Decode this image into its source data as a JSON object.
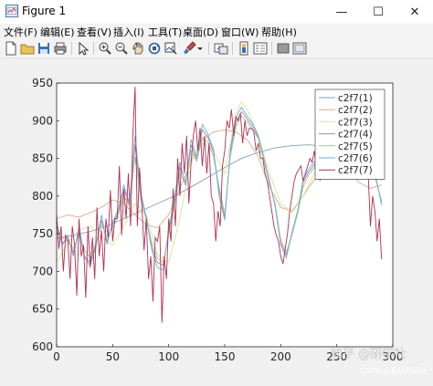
{
  "window": {
    "title": "Figure 1",
    "minimize_label": "—",
    "maximize_label": "☐",
    "close_label": "✕"
  },
  "menu": [
    "文件(F)",
    "编辑(E)",
    "查看(V)",
    "插入(I)",
    "工具(T)",
    "桌面(D)",
    "窗口(W)",
    "帮助(H)"
  ],
  "toolbar_icons": [
    "new-figure-icon",
    "open-file-icon",
    "save-icon",
    "print-icon",
    "edit-plot-icon",
    "zoom-in-icon",
    "zoom-out-icon",
    "pan-icon",
    "rotate-3d-icon",
    "data-cursor-icon",
    "brush-icon",
    "brush-dropdown-icon",
    "link-plot-icon",
    "insert-colorbar-icon",
    "insert-legend-icon",
    "hide-plot-tools-icon",
    "show-plot-tools-icon"
  ],
  "watermark": {
    "line1": "知乎 @研学社",
    "line2": "CSDN @荔枝科研社"
  },
  "chart_data": {
    "type": "line",
    "xlim": [
      0,
      300
    ],
    "ylim": [
      600,
      950
    ],
    "xticks": [
      "0",
      "50",
      "100",
      "150",
      "200",
      "250",
      "300"
    ],
    "yticks": [
      "600",
      "650",
      "700",
      "750",
      "800",
      "850",
      "900",
      "950"
    ],
    "xtick_values": [
      0,
      50,
      100,
      150,
      200,
      250,
      300
    ],
    "ytick_values": [
      600,
      650,
      700,
      750,
      800,
      850,
      900,
      950
    ],
    "legend_position": "top-right",
    "grid": false,
    "series": [
      {
        "name": "c2f7(1)",
        "color": "#7fa0c0",
        "x": [
          0,
          15,
          30,
          45,
          60,
          75,
          90,
          105,
          120,
          135,
          150,
          165,
          180,
          195,
          210,
          225,
          240,
          255,
          270,
          285,
          290
        ],
        "y": [
          744,
          748,
          753,
          760,
          770,
          780,
          790,
          800,
          812,
          825,
          838,
          850,
          858,
          864,
          867,
          868,
          866,
          862,
          855,
          847,
          845
        ]
      },
      {
        "name": "c2f7(2)",
        "color": "#d6ad8c",
        "x": [
          0,
          10,
          20,
          30,
          40,
          50,
          60,
          70,
          80,
          90,
          100,
          110,
          120,
          130,
          140,
          150,
          160,
          170,
          180,
          190,
          200,
          210,
          220,
          230,
          240,
          250,
          260,
          270,
          280,
          290
        ],
        "y": [
          770,
          775,
          772,
          778,
          785,
          795,
          790,
          775,
          762,
          758,
          775,
          810,
          845,
          875,
          885,
          888,
          885,
          875,
          852,
          812,
          785,
          780,
          800,
          822,
          838,
          843,
          835,
          818,
          810,
          815
        ]
      },
      {
        "name": "c2f7(3)",
        "color": "#e3df93",
        "x": [
          0,
          10,
          20,
          30,
          40,
          50,
          60,
          70,
          80,
          90,
          100,
          110,
          120,
          130,
          140,
          150,
          160,
          165,
          170,
          180,
          190,
          200,
          210,
          220,
          230,
          240,
          250,
          260,
          270,
          280,
          290
        ],
        "y": [
          712,
          738,
          755,
          760,
          745,
          735,
          760,
          790,
          775,
          722,
          712,
          770,
          850,
          870,
          860,
          830,
          910,
          925,
          915,
          880,
          830,
          790,
          778,
          800,
          830,
          850,
          848,
          835,
          828,
          840,
          820
        ]
      },
      {
        "name": "c2f7(4)",
        "color": "#9b8ab0",
        "x": [
          0,
          5,
          10,
          15,
          20,
          25,
          30,
          35,
          40,
          45,
          50,
          55,
          60,
          65,
          70,
          75,
          80,
          85,
          90,
          95,
          100,
          105,
          110,
          115,
          120,
          125,
          130,
          135,
          140,
          145,
          150,
          155,
          160,
          165,
          170,
          175,
          180,
          185,
          190,
          195,
          200,
          205,
          210,
          215,
          220,
          225,
          230,
          235,
          240,
          245,
          250,
          255,
          260,
          265,
          270,
          275,
          280,
          285,
          290
        ],
        "y": [
          760,
          738,
          742,
          725,
          752,
          720,
          712,
          735,
          768,
          740,
          762,
          778,
          808,
          792,
          868,
          802,
          772,
          732,
          712,
          708,
          752,
          792,
          838,
          818,
          868,
          848,
          888,
          878,
          858,
          808,
          772,
          858,
          898,
          912,
          902,
          892,
          878,
          848,
          818,
          788,
          738,
          722,
          748,
          778,
          818,
          832,
          842,
          822,
          832,
          852,
          848,
          838,
          852,
          862,
          858,
          838,
          848,
          822,
          792
        ]
      },
      {
        "name": "c2f7(5)",
        "color": "#a8c890",
        "x": [
          0,
          5,
          10,
          15,
          20,
          25,
          30,
          35,
          40,
          45,
          50,
          55,
          60,
          65,
          70,
          75,
          80,
          85,
          90,
          95,
          100,
          105,
          110,
          115,
          120,
          125,
          130,
          135,
          140,
          145,
          150,
          155,
          160,
          165,
          170,
          175,
          180,
          185,
          190,
          195,
          200,
          205,
          210,
          215,
          220,
          225,
          230,
          235,
          240,
          245,
          250,
          255,
          260,
          265,
          270,
          275,
          280,
          285,
          290
        ],
        "y": [
          752,
          745,
          740,
          730,
          748,
          728,
          718,
          738,
          762,
          746,
          758,
          774,
          800,
          788,
          852,
          796,
          768,
          738,
          718,
          712,
          748,
          786,
          830,
          816,
          860,
          846,
          878,
          872,
          852,
          812,
          776,
          852,
          892,
          906,
          898,
          888,
          876,
          846,
          816,
          790,
          742,
          726,
          748,
          776,
          812,
          828,
          838,
          820,
          830,
          848,
          844,
          836,
          848,
          858,
          854,
          836,
          844,
          820,
          794
        ]
      },
      {
        "name": "c2f7(6)",
        "color": "#6aaed8",
        "x": [
          0,
          5,
          10,
          15,
          20,
          25,
          30,
          35,
          40,
          45,
          50,
          55,
          60,
          65,
          70,
          75,
          80,
          85,
          90,
          95,
          100,
          105,
          110,
          115,
          120,
          125,
          130,
          135,
          140,
          145,
          150,
          155,
          160,
          165,
          170,
          175,
          180,
          185,
          190,
          195,
          200,
          205,
          210,
          215,
          220,
          225,
          230,
          235,
          240,
          245,
          250,
          255,
          260,
          265,
          270,
          275,
          280,
          285,
          290
        ],
        "y": [
          765,
          735,
          748,
          720,
          760,
          718,
          708,
          732,
          775,
          736,
          766,
          782,
          815,
          788,
          880,
          806,
          770,
          728,
          705,
          702,
          756,
          796,
          845,
          814,
          875,
          852,
          895,
          882,
          862,
          800,
          768,
          862,
          905,
          918,
          906,
          896,
          880,
          850,
          820,
          786,
          735,
          718,
          752,
          780,
          822,
          836,
          846,
          826,
          836,
          856,
          852,
          840,
          856,
          866,
          862,
          840,
          852,
          824,
          788
        ]
      },
      {
        "name": "c2f7(7)",
        "color": "#b03050",
        "x": [
          0,
          2,
          4,
          6,
          8,
          10,
          12,
          14,
          16,
          18,
          20,
          22,
          24,
          26,
          28,
          30,
          32,
          34,
          36,
          38,
          40,
          42,
          44,
          46,
          48,
          50,
          52,
          54,
          56,
          58,
          60,
          62,
          64,
          66,
          68,
          70,
          72,
          74,
          76,
          78,
          80,
          82,
          84,
          86,
          88,
          90,
          92,
          94,
          96,
          98,
          100,
          102,
          104,
          106,
          108,
          110,
          112,
          114,
          116,
          118,
          120,
          122,
          124,
          126,
          128,
          130,
          132,
          134,
          136,
          138,
          140,
          142,
          144,
          146,
          148,
          150,
          152,
          154,
          156,
          158,
          160,
          162,
          164,
          166,
          168,
          170,
          172,
          174,
          176,
          178,
          180,
          182,
          184,
          186,
          188,
          190,
          192,
          194,
          196,
          198,
          200,
          202,
          204,
          206,
          208,
          210,
          212,
          214,
          216,
          218,
          220,
          222,
          224,
          226,
          228,
          230,
          232,
          234,
          236,
          238,
          240,
          242,
          244,
          246,
          248,
          250,
          252,
          254,
          256,
          258,
          260,
          262,
          264,
          266,
          268,
          270,
          272,
          274,
          276,
          278,
          280,
          282,
          284,
          286,
          288,
          290
        ],
        "y": [
          775,
          730,
          760,
          700,
          748,
          742,
          690,
          760,
          735,
          668,
          770,
          720,
          735,
          665,
          760,
          705,
          745,
          690,
          785,
          720,
          755,
          700,
          770,
          745,
          808,
          740,
          770,
          770,
          840,
          748,
          810,
          770,
          830,
          760,
          880,
          945,
          760,
          838,
          790,
          728,
          770,
          690,
          720,
          660,
          745,
          740,
          760,
          632,
          720,
          690,
          770,
          740,
          810,
          760,
          850,
          800,
          870,
          830,
          880,
          790,
          845,
          880,
          900,
          860,
          890,
          840,
          880,
          830,
          870,
          800,
          790,
          740,
          780,
          760,
          840,
          860,
          900,
          890,
          915,
          880,
          905,
          900,
          910,
          870,
          900,
          880,
          890,
          890,
          885,
          860,
          870,
          850,
          850,
          830,
          820,
          800,
          780,
          760,
          748,
          740,
          720,
          710,
          730,
          750,
          780,
          800,
          820,
          830,
          835,
          840,
          820,
          830,
          840,
          850,
          845,
          860,
          835,
          850,
          870,
          850,
          858,
          842,
          855,
          848,
          870,
          860,
          850,
          870,
          860,
          880,
          855,
          870,
          860,
          840,
          880,
          850,
          860,
          840,
          850,
          830,
          760,
          800,
          780,
          740,
          770,
          716
        ]
      }
    ]
  }
}
